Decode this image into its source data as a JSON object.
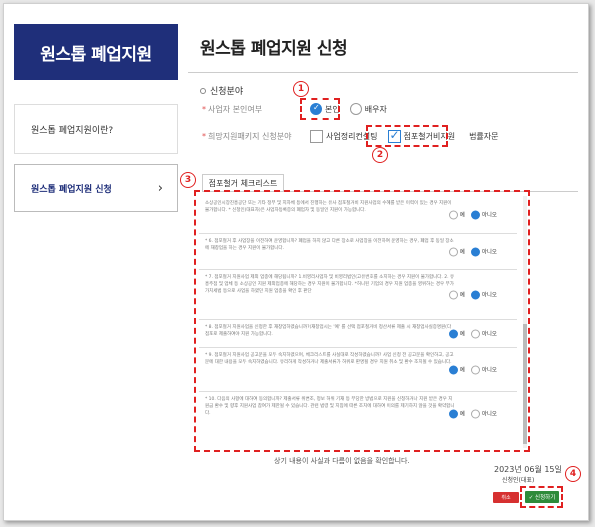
{
  "brand": "원스톱 폐업지원",
  "sidenav": {
    "items": [
      {
        "label": "원스톱 폐업지원이란?"
      },
      {
        "label": "원스톱 폐업지원 신청",
        "chevron": "›"
      }
    ]
  },
  "page_title": "원스톱 폐업지원 신청",
  "section": {
    "label": "신청분야"
  },
  "form": {
    "applicant_type": {
      "label": "사업자 본인여부",
      "options": [
        {
          "label": "본인",
          "selected": true
        },
        {
          "label": "배우자",
          "selected": false
        }
      ]
    },
    "package": {
      "label": "희망지원패키지 신청분야",
      "options": [
        {
          "label": "사업정리컨설팅",
          "checked": false
        },
        {
          "label": "점포철거비지원",
          "checked": true
        },
        {
          "label": "법률자문",
          "checked": false
        }
      ]
    }
  },
  "annotations": {
    "n1": "1",
    "n2": "2",
    "n3": "3",
    "n4": "4"
  },
  "tab": {
    "label": "점포철거 체크리스트"
  },
  "answer_labels": {
    "yes": "예",
    "no": "아니오"
  },
  "checklist": [
    {
      "text": "소상공인시장진흥공단 또는 기타 정부 및 지자체 등에서 진행하는 유사 점포철거비 지원사업의 수혜를 받은 이력이 있는 경우 지원이 불가합니다. * 신청인(대표자)은 사업자등록증의 폐업자 및 동일인 지원이 가능합니다.",
      "answer": "no"
    },
    {
      "text": "* 6. 점포철거 후 사업장을 이전하여 운영합니까? 폐업을 하지 않고 다른 장소로 사업장을 이전하여 운영하는 경우, 폐업 후 동일 장소에 재창업을 하는 경우 지원이 불가합니다.",
      "answer": "no"
    },
    {
      "text": "* 7. 점포철거 지원사업 제외 업종에 해당됩니까? 1.비영리사업자 및 비영리법인(고유번호를 소지하는 경우 지원이 불가합니다. 2. 유흥주점 및 업체 등 소상공인 지원 제외업종에 해당하는 경우 지원이 불가합니다. *허니된 기업의 경우 지원 업종을 영위하는 경우 부가가치세법 등으로 사업을 하였던 지원 업종을 확인 후 판단",
      "answer": "no"
    },
    {
      "text": "* 8. 점포철거 지원사업을 신청한 후 재창업하였습니까?(재창업시는 '예' 를 선택 점포철거비 정산서류 제출 시 재창업사실증명원(다 점포로 제출하여야 지원 가능합니다.",
      "answer": "yes"
    },
    {
      "text": "* 9. 점포철거 지원사업 공고문을 모두 숙지하였으며, 체크리스트를 사실대로 작성하였습니까? 사업 신청 전 공고문을 확인하고, 공고문에 대한 내용을 모두 숙지하였습니다. 유리하게 작성하거나 제출서류가 허위로 판명될 경우 지원 취소 및 환수 조치될 수 있습니다.",
      "answer": "yes"
    },
    {
      "text": "* 10. 다음의 사항에 대하여 동의합니까? 제출서류 위변조, 정보 허위 기재 등 부당한 방법으로 지원을 신청하거나 지원 받은 경우 지원금 환수 및 향후 지원사업 참여가 제한될 수 있습니다. 관련 법령 및 지침에 따른 조치에 대하여 이의를 제기하지 않을 것을 확약합니다.",
      "answer": "yes"
    }
  ],
  "confirm_text": "상기 내용이 사실과 다름이 없음을 확인합니다.",
  "date": "2023년 06월 15일",
  "applicant_line": "신청인(대표)",
  "buttons": {
    "cancel": "취소",
    "apply": "✓ 신청하기"
  },
  "colors": {
    "brand": "#1f2f7a",
    "accent": "#2a7fd4",
    "annotation": "#e02020",
    "apply": "#2e8b3a",
    "cancel": "#d63030"
  }
}
